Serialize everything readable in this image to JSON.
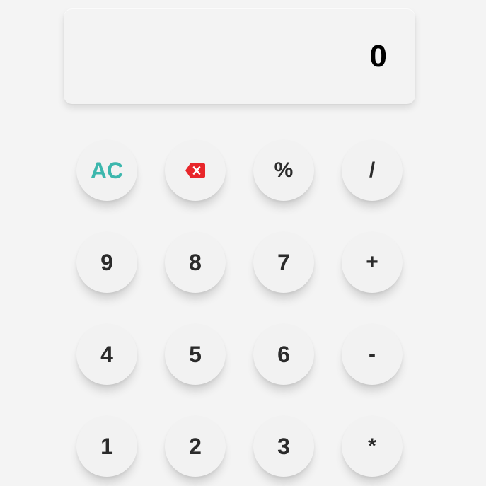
{
  "display": {
    "value": "0"
  },
  "colors": {
    "accent": "#3cb7ad",
    "backspace": "#e8262a"
  },
  "keys": [
    {
      "label": "AC",
      "name": "clear-button"
    },
    {
      "label": "",
      "name": "backspace-button",
      "icon": "backspace-icon"
    },
    {
      "label": "%",
      "name": "percent-button"
    },
    {
      "label": "/",
      "name": "divide-button"
    },
    {
      "label": "9",
      "name": "digit-9-button"
    },
    {
      "label": "8",
      "name": "digit-8-button"
    },
    {
      "label": "7",
      "name": "digit-7-button"
    },
    {
      "label": "+",
      "name": "add-button"
    },
    {
      "label": "4",
      "name": "digit-4-button"
    },
    {
      "label": "5",
      "name": "digit-5-button"
    },
    {
      "label": "6",
      "name": "digit-6-button"
    },
    {
      "label": "-",
      "name": "subtract-button"
    },
    {
      "label": "1",
      "name": "digit-1-button"
    },
    {
      "label": "2",
      "name": "digit-2-button"
    },
    {
      "label": "3",
      "name": "digit-3-button"
    },
    {
      "label": "*",
      "name": "multiply-button"
    }
  ]
}
